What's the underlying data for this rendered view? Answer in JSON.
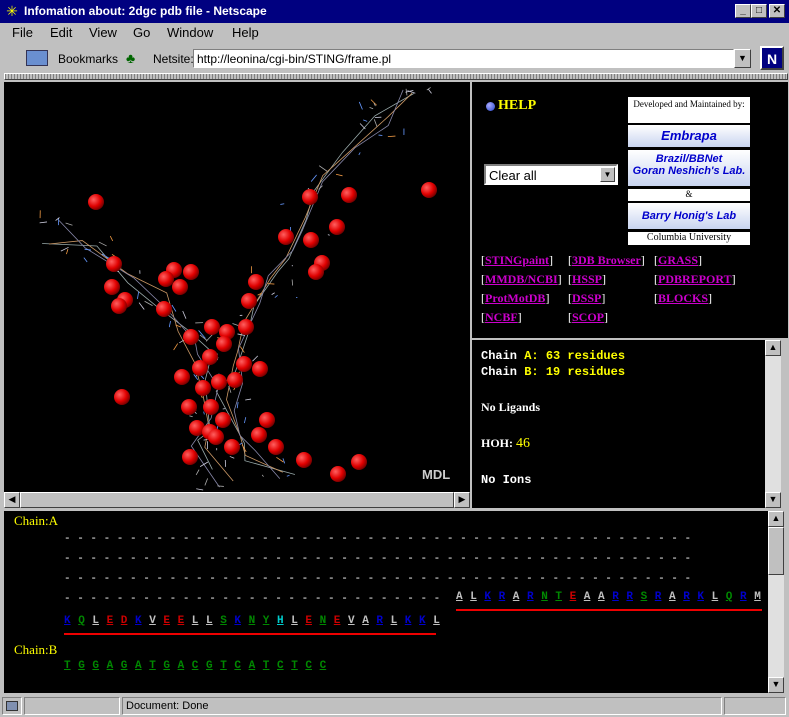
{
  "window": {
    "title": "Infomation about: 2dgc pdb file - Netscape",
    "minimize": "_",
    "maximize": "□",
    "close": "✕"
  },
  "menu": [
    "File",
    "Edit",
    "View",
    "Go",
    "Window",
    "Help"
  ],
  "toolbar": {
    "bookmarks": "Bookmarks",
    "netsite_label": "Netsite:",
    "url": "http://leonina/cgi-bin/STING/frame.pl"
  },
  "viewer": {
    "watermark": "MDL"
  },
  "panel": {
    "help": "HELP",
    "select_value": "Clear all",
    "credits": {
      "developed": "Developed and Maintained by:",
      "embrapa": "Embrapa",
      "brazil1": "Brazil/BBNet",
      "brazil2": "Goran Neshich's Lab.",
      "amp": "&",
      "honig": "Barry Honig's Lab",
      "columbia": "Columbia University"
    },
    "links": [
      "STINGpaint",
      "3DB Browser",
      "GRASS",
      "MMDB/NCBI",
      "HSSP",
      "PDBREPORT",
      "ProtMotDB",
      "DSSP",
      "BLOCKS",
      "NCBF",
      "SCOP"
    ]
  },
  "info": {
    "chainA_label": "Chain ",
    "chainA_id": "A",
    "chainA_rest": ": 63 residues",
    "chainB_label": "Chain ",
    "chainB_id": "B",
    "chainB_rest": ": 19 residues",
    "ligands": "No Ligands",
    "hoh_label": "HOH:",
    "hoh_count": "46",
    "ions": "No Ions"
  },
  "sequence": {
    "chainA_label": "Chain:A",
    "chainB_label": "Chain:B",
    "dots_row": "- - - - - - - - - - - - - - - - - - - - - - - - - - - - - - - - - - - - - - - - - - - - - - - -",
    "dots_row4": "- - - - - - - - - - - - - - - - - - - - - - - - - - - - -",
    "chainA_row4": [
      [
        "A",
        "#c0c0c0"
      ],
      [
        "L",
        "#c0c0c0"
      ],
      [
        "K",
        "#00c"
      ],
      [
        "R",
        "#00c"
      ],
      [
        "A",
        "#c0c0c0"
      ],
      [
        "R",
        "#00c"
      ],
      [
        "N",
        "#080"
      ],
      [
        "T",
        "#080"
      ],
      [
        "E",
        "#c00"
      ],
      [
        "A",
        "#c0c0c0"
      ],
      [
        "A",
        "#c0c0c0"
      ],
      [
        "R",
        "#00c"
      ],
      [
        "R",
        "#00c"
      ],
      [
        "S",
        "#080"
      ],
      [
        "R",
        "#00c"
      ],
      [
        "A",
        "#c0c0c0"
      ],
      [
        "R",
        "#00c"
      ],
      [
        "K",
        "#00c"
      ],
      [
        "L",
        "#c0c0c0"
      ],
      [
        "Q",
        "#080"
      ],
      [
        "R",
        "#00c"
      ],
      [
        "M",
        "#c0c0c0"
      ]
    ],
    "chainA_row5": [
      [
        "K",
        "#00c"
      ],
      [
        "Q",
        "#080"
      ],
      [
        "L",
        "#c0c0c0"
      ],
      [
        "E",
        "#c00"
      ],
      [
        "D",
        "#c00"
      ],
      [
        "K",
        "#00c"
      ],
      [
        "V",
        "#c0c0c0"
      ],
      [
        "E",
        "#c00"
      ],
      [
        "E",
        "#c00"
      ],
      [
        "L",
        "#c0c0c0"
      ],
      [
        "L",
        "#c0c0c0"
      ],
      [
        "S",
        "#080"
      ],
      [
        "K",
        "#00c"
      ],
      [
        "N",
        "#080"
      ],
      [
        "Y",
        "#080"
      ],
      [
        "H",
        "#0cc"
      ],
      [
        "L",
        "#c0c0c0"
      ],
      [
        "E",
        "#c00"
      ],
      [
        "N",
        "#080"
      ],
      [
        "E",
        "#c00"
      ],
      [
        "V",
        "#c0c0c0"
      ],
      [
        "A",
        "#c0c0c0"
      ],
      [
        "R",
        "#00c"
      ],
      [
        "L",
        "#c0c0c0"
      ],
      [
        "K",
        "#00c"
      ],
      [
        "K",
        "#00c"
      ],
      [
        "L",
        "#c0c0c0"
      ]
    ],
    "chainB": [
      [
        "T",
        "#080"
      ],
      [
        "G",
        "#080"
      ],
      [
        "G",
        "#080"
      ],
      [
        "A",
        "#080"
      ],
      [
        "G",
        "#080"
      ],
      [
        "A",
        "#080"
      ],
      [
        "T",
        "#080"
      ],
      [
        "G",
        "#080"
      ],
      [
        "A",
        "#080"
      ],
      [
        "C",
        "#080"
      ],
      [
        "G",
        "#080"
      ],
      [
        "T",
        "#080"
      ],
      [
        "C",
        "#080"
      ],
      [
        "A",
        "#080"
      ],
      [
        "T",
        "#080"
      ],
      [
        "C",
        "#080"
      ],
      [
        "T",
        "#080"
      ],
      [
        "C",
        "#080"
      ],
      [
        "C",
        "#080"
      ]
    ]
  },
  "status": {
    "text": "Document: Done"
  }
}
